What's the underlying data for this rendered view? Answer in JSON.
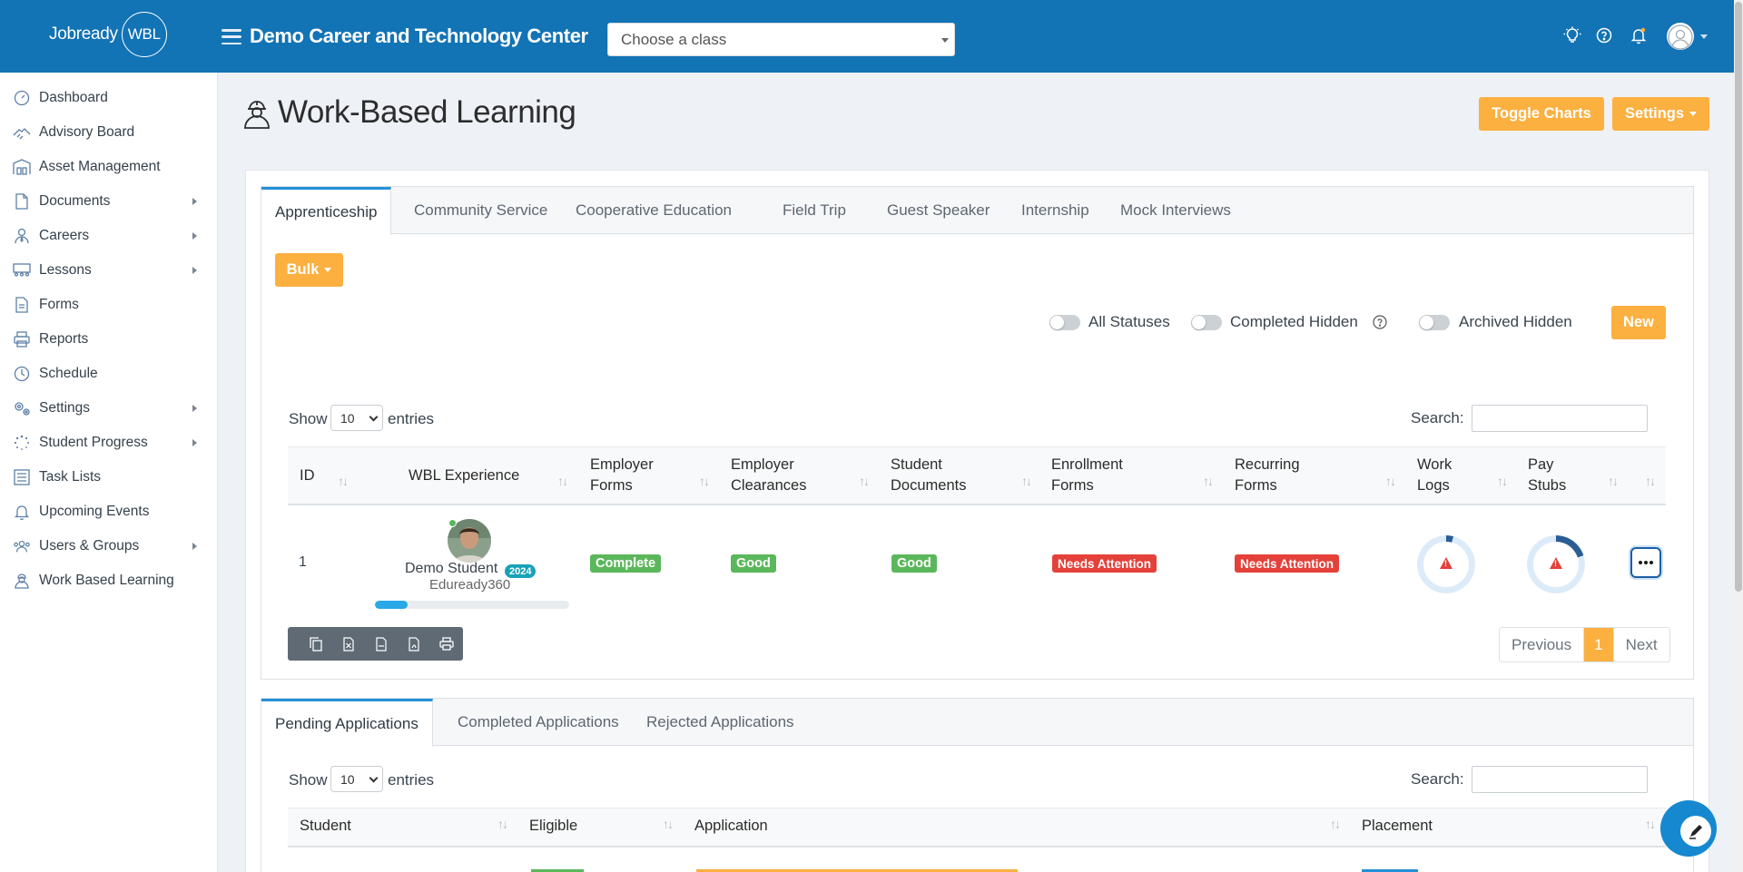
{
  "topbar": {
    "logo_text": "Jobready",
    "logo_badge": "WBL",
    "org_title": "Demo Career and Technology Center",
    "class_select_placeholder": "Choose a class"
  },
  "sidebar": {
    "items": [
      {
        "label": "Dashboard",
        "icon": "gauge-icon",
        "has_submenu": false
      },
      {
        "label": "Advisory Board",
        "icon": "handshake-icon",
        "has_submenu": false
      },
      {
        "label": "Asset Management",
        "icon": "warehouse-icon",
        "has_submenu": false
      },
      {
        "label": "Documents",
        "icon": "file-icon",
        "has_submenu": true
      },
      {
        "label": "Careers",
        "icon": "user-tie-icon",
        "has_submenu": true
      },
      {
        "label": "Lessons",
        "icon": "users-class-icon",
        "has_submenu": true
      },
      {
        "label": "Forms",
        "icon": "form-icon",
        "has_submenu": false
      },
      {
        "label": "Reports",
        "icon": "printer-icon",
        "has_submenu": false
      },
      {
        "label": "Schedule",
        "icon": "clock-icon",
        "has_submenu": false
      },
      {
        "label": "Settings",
        "icon": "gears-icon",
        "has_submenu": true
      },
      {
        "label": "Student Progress",
        "icon": "spinner-icon",
        "has_submenu": true
      },
      {
        "label": "Task Lists",
        "icon": "list-icon",
        "has_submenu": false
      },
      {
        "label": "Upcoming Events",
        "icon": "bell-icon",
        "has_submenu": false
      },
      {
        "label": "Users & Groups",
        "icon": "users-icon",
        "has_submenu": true
      },
      {
        "label": "Work Based Learning",
        "icon": "worker-icon",
        "has_submenu": false
      }
    ]
  },
  "page": {
    "title": "Work-Based Learning",
    "toggle_charts_label": "Toggle Charts",
    "settings_label": "Settings"
  },
  "wbl_tabs": [
    "Apprenticeship",
    "Community Service",
    "Cooperative Education",
    "Field Trip",
    "Guest Speaker",
    "Internship",
    "Mock Interviews"
  ],
  "wbl_panel": {
    "bulk_label": "Bulk",
    "toggles": [
      "All Statuses",
      "Completed Hidden",
      "Archived Hidden"
    ],
    "new_label": "New",
    "show_label": "Show",
    "entries_value": "10",
    "entries_label": "entries",
    "search_label": "Search:",
    "columns": [
      {
        "label": "ID"
      },
      {
        "label": "WBL Experience"
      },
      {
        "label": "Employer Forms",
        "line1": "Employer",
        "line2": "Forms"
      },
      {
        "label": "Employer Clearances",
        "line1": "Employer",
        "line2": "Clearances"
      },
      {
        "label": "Student Documents",
        "line1": "Student",
        "line2": "Documents"
      },
      {
        "label": "Enrollment Forms",
        "line1": "Enrollment",
        "line2": "Forms"
      },
      {
        "label": "Recurring Forms",
        "line1": "Recurring",
        "line2": "Forms"
      },
      {
        "label": "Work Logs",
        "line1": "Work",
        "line2": "Logs"
      },
      {
        "label": "Pay Stubs",
        "line1": "Pay",
        "line2": "Stubs"
      }
    ],
    "rows": [
      {
        "id": "1",
        "student_name": "Demo Student",
        "year_badge": "2024",
        "organization": "Eduready360",
        "progress": 0.17,
        "employer_forms": "Complete",
        "employer_clearances": "Good",
        "student_documents": "Good",
        "enrollment_forms": "Needs Attention",
        "recurring_forms": "Needs Attention",
        "work_logs_progress": 0.04,
        "pay_stubs_progress": 0.2
      }
    ],
    "pager": {
      "previous": "Previous",
      "current": "1",
      "next": "Next"
    }
  },
  "applications_tabs": [
    "Pending Applications",
    "Completed Applications",
    "Rejected Applications"
  ],
  "applications_panel": {
    "show_label": "Show",
    "entries_value": "10",
    "entries_label": "entries",
    "search_label": "Search:",
    "columns": [
      "Student",
      "Eligible",
      "Application",
      "Placement"
    ]
  },
  "colors": {
    "topbar": "#1273b5",
    "accent_orange": "#fbb040",
    "success_green": "#5bb75b",
    "danger_red": "#e4413a",
    "tab_active_border": "#2491d6"
  }
}
